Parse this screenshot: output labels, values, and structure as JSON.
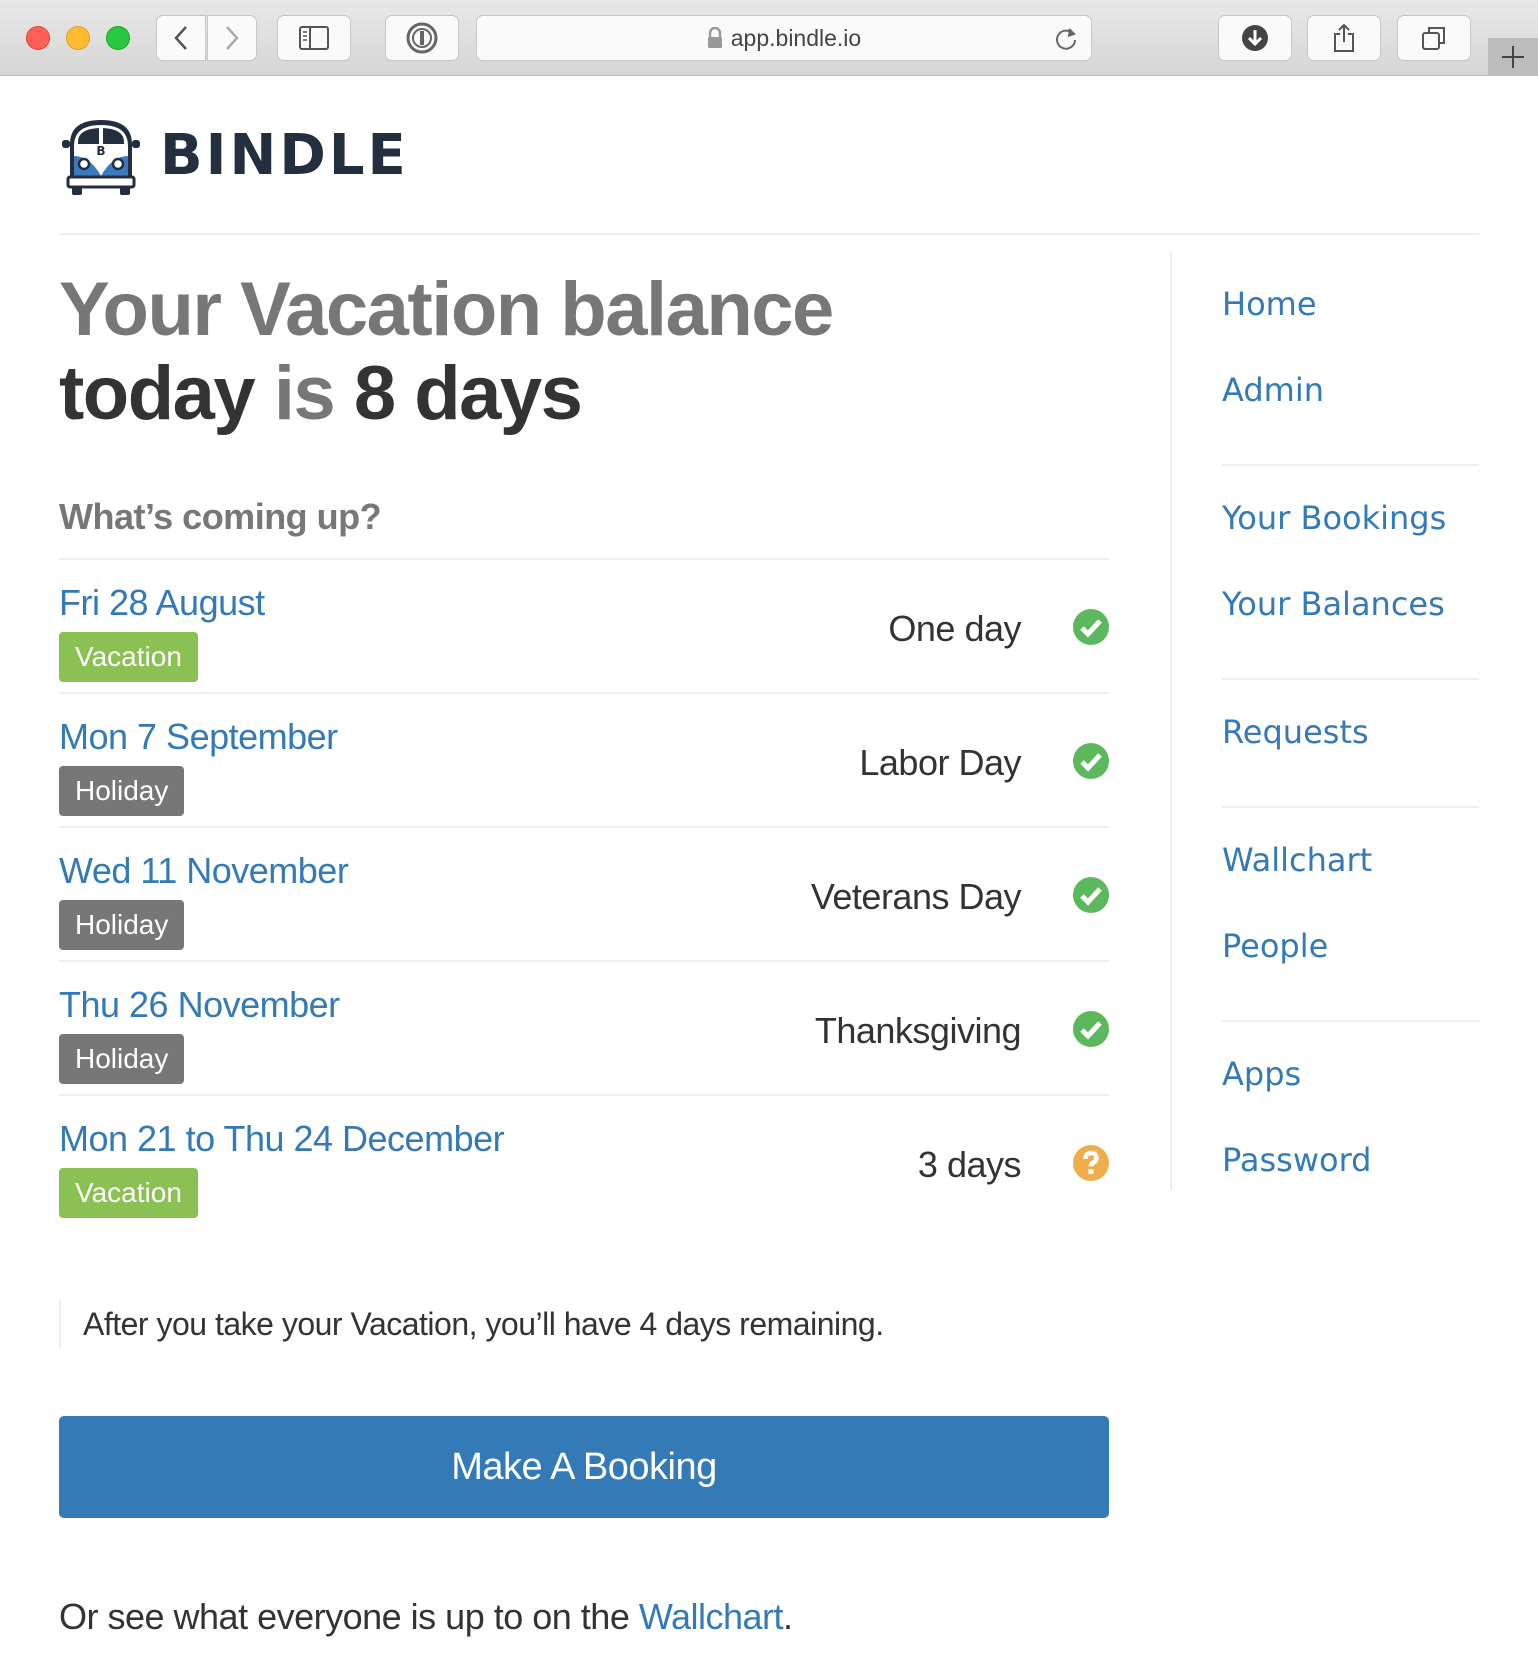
{
  "browser": {
    "url": "app.bindle.io",
    "icons": {
      "back": "chevron-left-icon",
      "forward": "chevron-right-icon",
      "sidebar": "sidebar-icon",
      "password_manager": "onepassword-icon",
      "lock": "lock-icon",
      "reload": "reload-icon",
      "download": "download-icon",
      "share": "share-icon",
      "tabs": "tabs-icon",
      "new_tab": "plus-icon"
    }
  },
  "brand": {
    "name": "BINDLE",
    "logo_icon": "van-icon",
    "logo_letter": "B"
  },
  "headline": {
    "part1": "Your Vacation balance",
    "part2": "today",
    "part3": " is ",
    "part4": "8 days"
  },
  "upcoming": {
    "title": "What’s coming up?",
    "items": [
      {
        "date": "Fri 28 August",
        "type": "Vacation",
        "type_color": "#8bc152",
        "description": "One day",
        "status": "approved"
      },
      {
        "date": "Mon 7 September",
        "type": "Holiday",
        "type_color": "#777777",
        "description": "Labor Day",
        "status": "approved"
      },
      {
        "date": "Wed 11 November",
        "type": "Holiday",
        "type_color": "#777777",
        "description": "Veterans Day",
        "status": "approved"
      },
      {
        "date": "Thu 26 November",
        "type": "Holiday",
        "type_color": "#777777",
        "description": "Thanksgiving",
        "status": "approved"
      },
      {
        "date": "Mon 21 to Thu 24 December",
        "type": "Vacation",
        "type_color": "#8bc152",
        "description": "3 days",
        "status": "pending"
      }
    ]
  },
  "note": "After you take your Vacation, you’ll have 4 days remaining.",
  "cta": {
    "label": "Make A Booking"
  },
  "footer": {
    "prefix": "Or see what everyone is up to on the ",
    "link": "Wallchart",
    "suffix": "."
  },
  "nav": {
    "groups": [
      [
        "Home",
        "Admin"
      ],
      [
        "Your Bookings",
        "Your Balances"
      ],
      [
        "Requests"
      ],
      [
        "Wallchart",
        "People"
      ],
      [
        "Apps",
        "Password"
      ]
    ]
  },
  "colors": {
    "link": "#337ab7",
    "approved": "#5cb85c",
    "pending": "#f0ad4e",
    "vacation": "#8bc152",
    "holiday": "#777777",
    "brand_dark": "#232f3f"
  }
}
